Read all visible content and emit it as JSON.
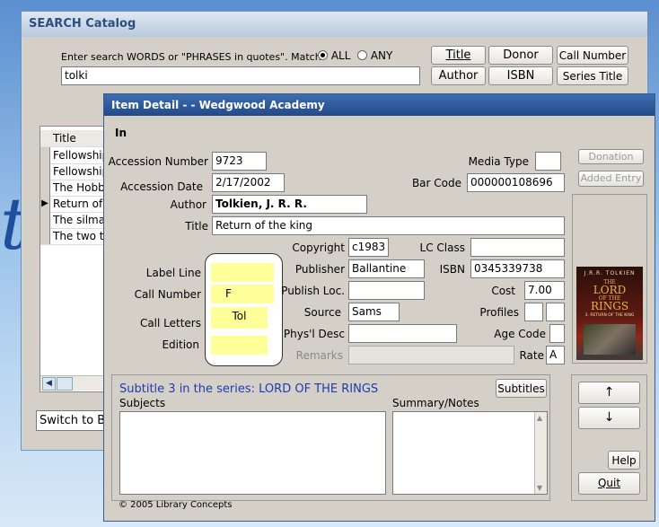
{
  "search": {
    "window_title": "SEARCH Catalog",
    "prompt": "Enter search WORDS or \"PHRASES in quotes\".  Match:",
    "match_all": "ALL",
    "match_any": "ANY",
    "query": "tolki",
    "buttons": {
      "title": "Title",
      "donor": "Donor",
      "call_number": "Call Number",
      "author": "Author",
      "isbn": "ISBN",
      "series_title": "Series Title"
    },
    "results_header": "Title",
    "results": [
      "Fellowship",
      "Fellowship",
      "The Hobbit",
      "Return of",
      "The silma",
      "The two to"
    ],
    "switch_label": "Switch to BR"
  },
  "detail": {
    "window_title": "Item Detail -  - Wedgwood Academy",
    "status": "In",
    "labels": {
      "accession_number": "Accession Number",
      "accession_date": "Accession Date",
      "author": "Author",
      "title": "Title",
      "media_type": "Media Type",
      "bar_code": "Bar Code",
      "copyright": "Copyright",
      "lc_class": "LC Class",
      "publisher": "Publisher",
      "isbn": "ISBN",
      "publish_loc": "Publish Loc.",
      "cost": "Cost",
      "source": "Source",
      "profiles": "Profiles",
      "phys_desc": "Phys'l Desc",
      "age_code": "Age Code",
      "remarks": "Remarks",
      "rate": "Rate",
      "label_line": "Label Line",
      "call_number": "Call Number",
      "call_letters": "Call Letters",
      "edition": "Edition",
      "subjects": "Subjects",
      "summary_notes": "Summary/Notes"
    },
    "values": {
      "accession_number": "9723",
      "accession_date": "2/17/2002",
      "author": "Tolkien, J. R. R.",
      "title": "Return of the king",
      "bar_code": "000000108696",
      "copyright": "c1983",
      "publisher": "Ballantine",
      "isbn": "0345339738",
      "cost": "7.00",
      "source": "Sams",
      "rate": "A",
      "call_number": "F",
      "call_letters": "Tol"
    },
    "buttons": {
      "donation": "Donation",
      "added_entry": "Added Entry",
      "subtitles": "Subtitles",
      "up": "↑",
      "down": "↓",
      "help": "Help",
      "quit": "Quit"
    },
    "subtitle_text": "Subtitle 3 in the series: LORD OF THE RINGS",
    "footer": "© 2005  Library Concepts",
    "cover": {
      "author_line": "J.R.R. TOLKIEN",
      "title_top": "THE",
      "title_main": "LORD",
      "title_of": "OF THE",
      "title_rings": "RINGS",
      "subtitle": "3. RETURN OF THE KING"
    },
    "colors": {
      "title_bar": "#2f5c9e",
      "subtitle_text": "#1f3bb3",
      "field_highlight": "#ffff99"
    }
  }
}
